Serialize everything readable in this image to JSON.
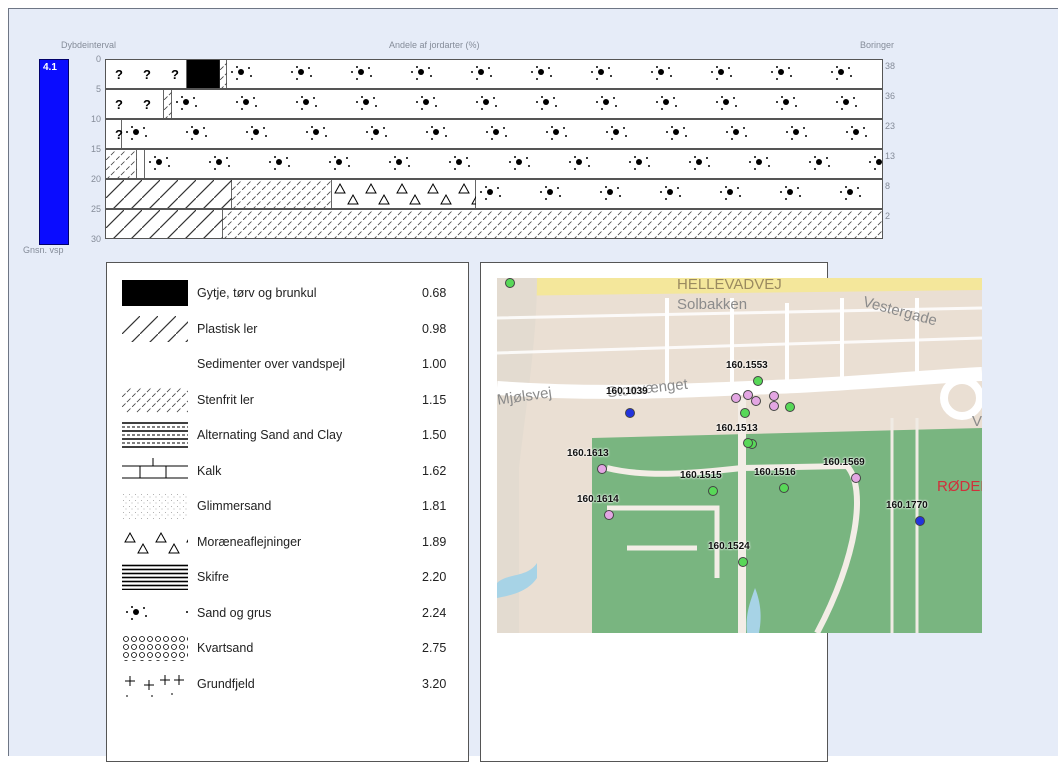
{
  "profile": {
    "depth_header": "Dybdeinterval",
    "share_header": "Andele af jordarter (%)",
    "borings_header": "Boringer",
    "avg_label": "Gnsn. vsp",
    "avg_value": "4.1",
    "ticks": [
      "0",
      "5",
      "10",
      "15",
      "20",
      "25",
      "30"
    ],
    "rows": [
      {
        "boringer": "38",
        "segments": [
          {
            "type": "unknown",
            "pct": 10.4
          },
          {
            "type": "gytje",
            "pct": 4.2
          },
          {
            "type": "stenfrit",
            "pct": 1.0
          },
          {
            "type": "sand",
            "pct": 84.4
          }
        ]
      },
      {
        "boringer": "36",
        "segments": [
          {
            "type": "unknown",
            "pct": 7.5
          },
          {
            "type": "stenfrit",
            "pct": 1.0
          },
          {
            "type": "sand",
            "pct": 91.5
          }
        ]
      },
      {
        "boringer": "23",
        "segments": [
          {
            "type": "unknown",
            "pct": 2.1
          },
          {
            "type": "sand",
            "pct": 97.9
          }
        ]
      },
      {
        "boringer": "13",
        "segments": [
          {
            "type": "stenfrit",
            "pct": 4.0
          },
          {
            "type": "blank",
            "pct": 1.0
          },
          {
            "type": "sand",
            "pct": 95.0
          }
        ]
      },
      {
        "boringer": "8",
        "segments": [
          {
            "type": "plastic",
            "pct": 16.2
          },
          {
            "type": "stenfrit",
            "pct": 12.8
          },
          {
            "type": "moraene",
            "pct": 18.6
          },
          {
            "type": "sand",
            "pct": 52.4
          }
        ]
      },
      {
        "boringer": "2",
        "segments": [
          {
            "type": "plastic",
            "pct": 15.0
          },
          {
            "type": "stenfrit",
            "pct": 85.0
          }
        ]
      }
    ]
  },
  "legend": [
    {
      "key": "gytje",
      "label": "Gytje, tørv og brunkul",
      "value": "0.68"
    },
    {
      "key": "plastic",
      "label": "Plastisk ler",
      "value": "0.98"
    },
    {
      "key": "blank",
      "label": "Sedimenter over vandspejl",
      "value": "1.00"
    },
    {
      "key": "stenfrit",
      "label": "Stenfrit ler",
      "value": "1.15"
    },
    {
      "key": "alternating",
      "label": "Alternating Sand and Clay",
      "value": "1.50"
    },
    {
      "key": "kalk",
      "label": "Kalk",
      "value": "1.62"
    },
    {
      "key": "glimmer",
      "label": "Glimmersand",
      "value": "1.81"
    },
    {
      "key": "moraene",
      "label": "Moræneaflejninger",
      "value": "1.89"
    },
    {
      "key": "skifre",
      "label": "Skifre",
      "value": "2.20"
    },
    {
      "key": "sand",
      "label": "Sand og grus",
      "value": "2.24"
    },
    {
      "key": "kvarts",
      "label": "Kvartsand",
      "value": "2.75"
    },
    {
      "key": "grundfjeld",
      "label": "Grundfjeld",
      "value": "3.20"
    }
  ],
  "map": {
    "streets": [
      "HELLEVADVEJ",
      "Solbakken",
      "Vestergade",
      "Mjølsvej",
      "Stoevænget",
      "RØDEK",
      "V"
    ],
    "borings": [
      {
        "id": "160.1553",
        "color": "#58d858"
      },
      {
        "id": "160.1039",
        "color": "#2233dd"
      },
      {
        "id": "160.1513",
        "color": "#58d858"
      },
      {
        "id": "160.1613",
        "color": "#e3a6e3"
      },
      {
        "id": "160.1515",
        "color": "#58d858"
      },
      {
        "id": "160.1516",
        "color": "#58d858"
      },
      {
        "id": "160.1569",
        "color": "#e3a6e3"
      },
      {
        "id": "160.1614",
        "color": "#e3a6e3"
      },
      {
        "id": "160.1770",
        "color": "#2233dd"
      },
      {
        "id": "160.1524",
        "color": "#58d858"
      }
    ],
    "extra_points": [
      {
        "color": "#58d858"
      },
      {
        "color": "#e3a6e3"
      },
      {
        "color": "#e3a6e3"
      },
      {
        "color": "#e3a6e3"
      },
      {
        "color": "#e3a6e3"
      },
      {
        "color": "#e3a6e3"
      },
      {
        "color": "#58d858"
      },
      {
        "color": "#58d858"
      },
      {
        "color": "#58d858"
      }
    ]
  }
}
